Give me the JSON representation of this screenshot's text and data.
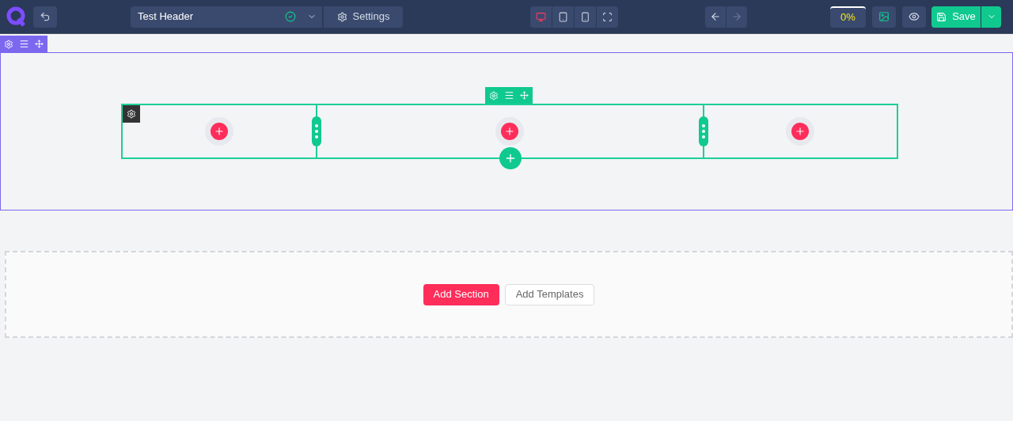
{
  "header": {
    "title": "Test Header",
    "settings_label": "Settings",
    "devices": [
      {
        "kind": "desktop",
        "selected": true
      },
      {
        "kind": "tablet",
        "selected": false
      },
      {
        "kind": "mobile",
        "selected": false
      },
      {
        "kind": "fullscreen",
        "selected": false
      }
    ],
    "history": [
      {
        "kind": "back",
        "disabled": false
      },
      {
        "kind": "forward",
        "disabled": true
      }
    ],
    "progress": "0%",
    "save_label": "Save"
  },
  "section": {
    "row": {
      "columns": [
        {
          "kind": "empty"
        },
        {
          "kind": "empty"
        },
        {
          "kind": "empty"
        }
      ]
    }
  },
  "add_area": {
    "buttons": [
      {
        "label": "Add Section",
        "kind": "primary"
      },
      {
        "label": "Add Templates",
        "kind": "secondary"
      }
    ]
  }
}
